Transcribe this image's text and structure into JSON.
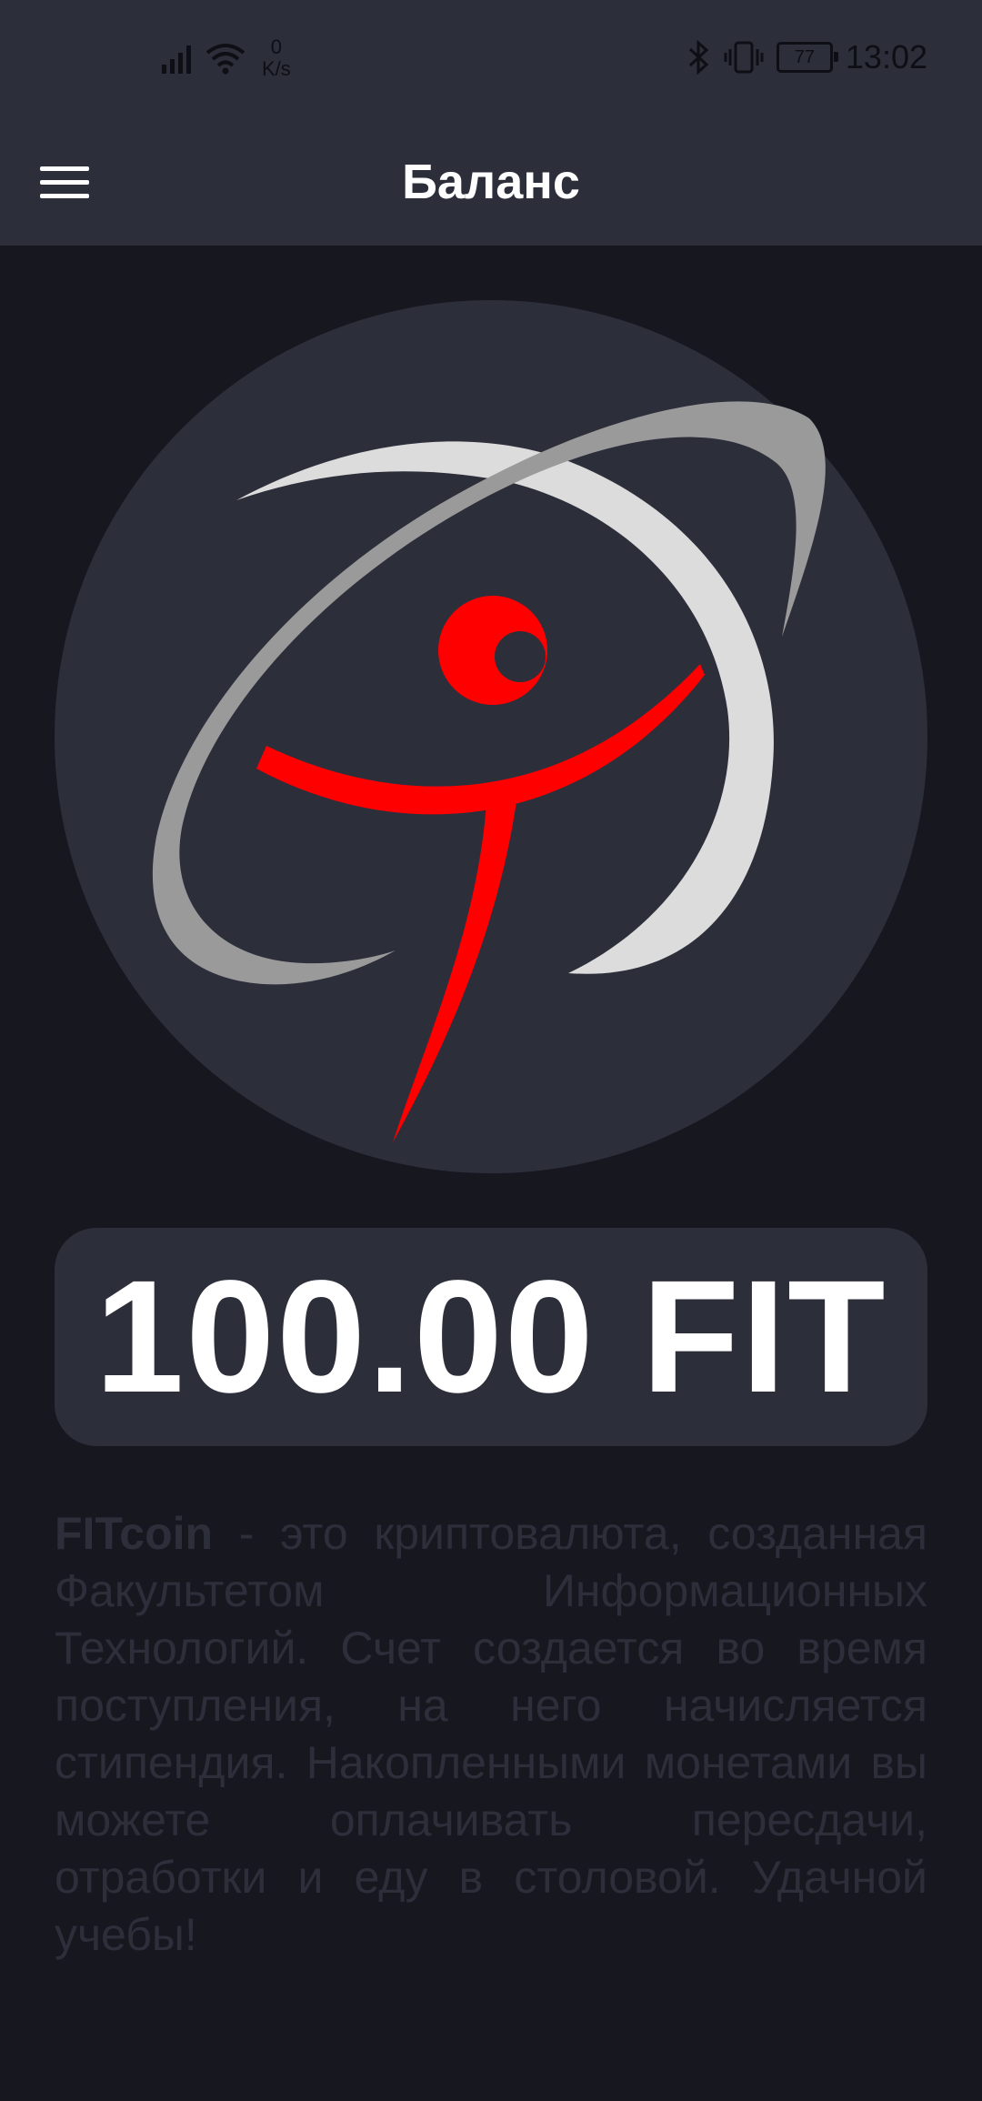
{
  "status_bar": {
    "speed_value": "0",
    "speed_unit": "K/s",
    "battery": "77",
    "time": "13:02"
  },
  "header": {
    "title": "Баланс",
    "menu_icon": "hamburger-menu-icon"
  },
  "logo": {
    "icon": "fitcoin-logo",
    "colors": {
      "circle": "#2c2e3a",
      "orbit_light": "#dcdcdc",
      "orbit_gray": "#9a9a9a",
      "figure": "#ff0000"
    }
  },
  "balance": {
    "amount": "100.00 FIT"
  },
  "description": {
    "brand": "FITcoin",
    "text": " - это криптовалюта, созданная Факультетом Информационных Технологий. Счет создается во время поступления, на него начисляется стипендия. Накопленными монетами вы можете оплачивать пересдачи, отработки и еду в столовой. Удачной учебы!"
  },
  "colors": {
    "background": "#16171f",
    "surface": "#2c2e3a",
    "text_primary": "#ffffff",
    "accent_red": "#ff0000"
  }
}
